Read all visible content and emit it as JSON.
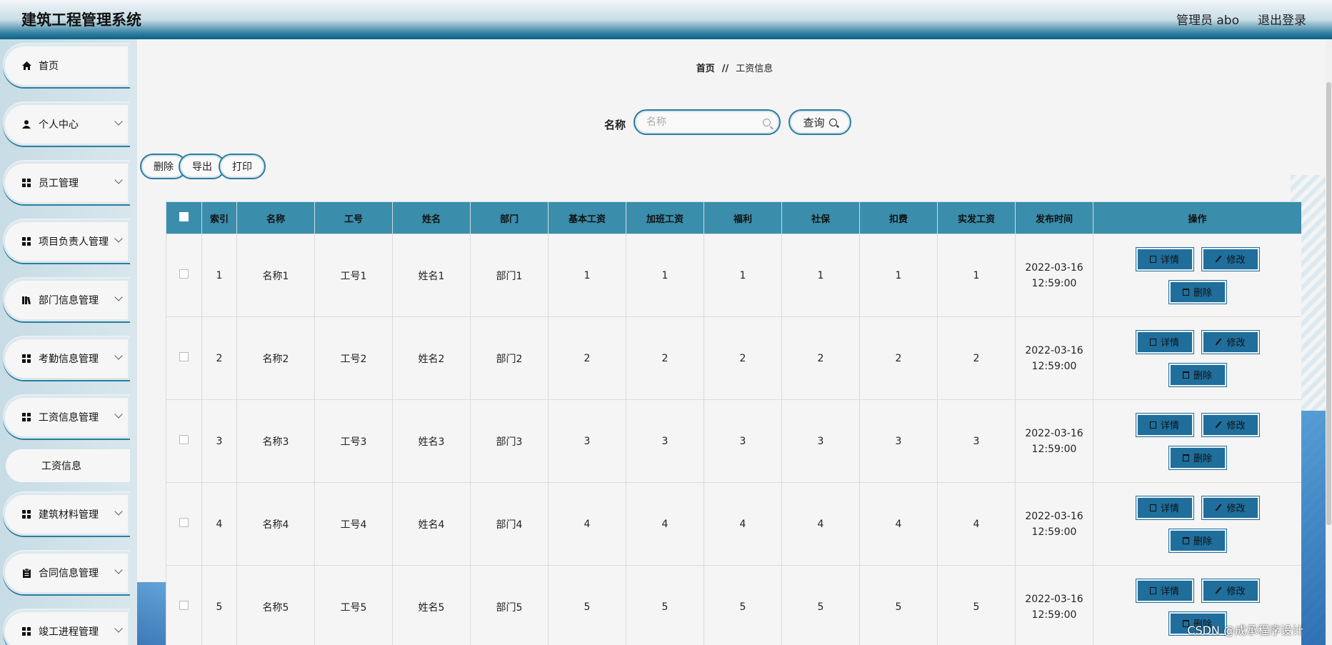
{
  "header": {
    "app_title": "建筑工程管理系统",
    "user_label": "管理员 abo",
    "logout_label": "退出登录"
  },
  "sidebar": {
    "items": [
      {
        "label": "首页",
        "icon": "home-icon"
      },
      {
        "label": "个人中心",
        "icon": "user-icon"
      },
      {
        "label": "员工管理",
        "icon": "grid-icon"
      },
      {
        "label": "项目负责人管理",
        "icon": "grid-icon"
      },
      {
        "label": "部门信息管理",
        "icon": "books-icon"
      },
      {
        "label": "考勤信息管理",
        "icon": "grid-icon"
      },
      {
        "label": "工资信息管理",
        "icon": "grid-icon"
      },
      {
        "label": "建筑材料管理",
        "icon": "grid-icon"
      },
      {
        "label": "合同信息管理",
        "icon": "clipboard-icon"
      },
      {
        "label": "竣工进程管理",
        "icon": "grid-icon"
      }
    ],
    "sub_item": "工资信息"
  },
  "breadcrumb": {
    "home": "首页",
    "separator": "//",
    "current": "工资信息"
  },
  "search": {
    "label": "名称",
    "placeholder": "名称",
    "button": "查询"
  },
  "toolbar": {
    "delete": "删除",
    "export": "导出",
    "print": "打印"
  },
  "table": {
    "headers": [
      "索引",
      "名称",
      "工号",
      "姓名",
      "部门",
      "基本工资",
      "加班工资",
      "福利",
      "社保",
      "扣费",
      "实发工资",
      "发布时间",
      "操作"
    ],
    "rows": [
      {
        "index": "1",
        "name": "名称1",
        "emp_no": "工号1",
        "person": "姓名1",
        "dept": "部门1",
        "base": "1",
        "overtime": "1",
        "welfare": "1",
        "social": "1",
        "deduct": "1",
        "net": "1",
        "date": "2022-03-16",
        "time": "12:59:00"
      },
      {
        "index": "2",
        "name": "名称2",
        "emp_no": "工号2",
        "person": "姓名2",
        "dept": "部门2",
        "base": "2",
        "overtime": "2",
        "welfare": "2",
        "social": "2",
        "deduct": "2",
        "net": "2",
        "date": "2022-03-16",
        "time": "12:59:00"
      },
      {
        "index": "3",
        "name": "名称3",
        "emp_no": "工号3",
        "person": "姓名3",
        "dept": "部门3",
        "base": "3",
        "overtime": "3",
        "welfare": "3",
        "social": "3",
        "deduct": "3",
        "net": "3",
        "date": "2022-03-16",
        "time": "12:59:00"
      },
      {
        "index": "4",
        "name": "名称4",
        "emp_no": "工号4",
        "person": "姓名4",
        "dept": "部门4",
        "base": "4",
        "overtime": "4",
        "welfare": "4",
        "social": "4",
        "deduct": "4",
        "net": "4",
        "date": "2022-03-16",
        "time": "12:59:00"
      },
      {
        "index": "5",
        "name": "名称5",
        "emp_no": "工号5",
        "person": "姓名5",
        "dept": "部门5",
        "base": "5",
        "overtime": "5",
        "welfare": "5",
        "social": "5",
        "deduct": "5",
        "net": "5",
        "date": "2022-03-16",
        "time": "12:59:00"
      }
    ],
    "row_actions": {
      "detail": "详情",
      "edit": "修改",
      "delete": "删除"
    }
  },
  "watermark": "CSDN @成承程序设计",
  "colors": {
    "header_accent": "#0d5f86",
    "table_header": "#3a8dab",
    "action_button": "#1f6e9c"
  }
}
